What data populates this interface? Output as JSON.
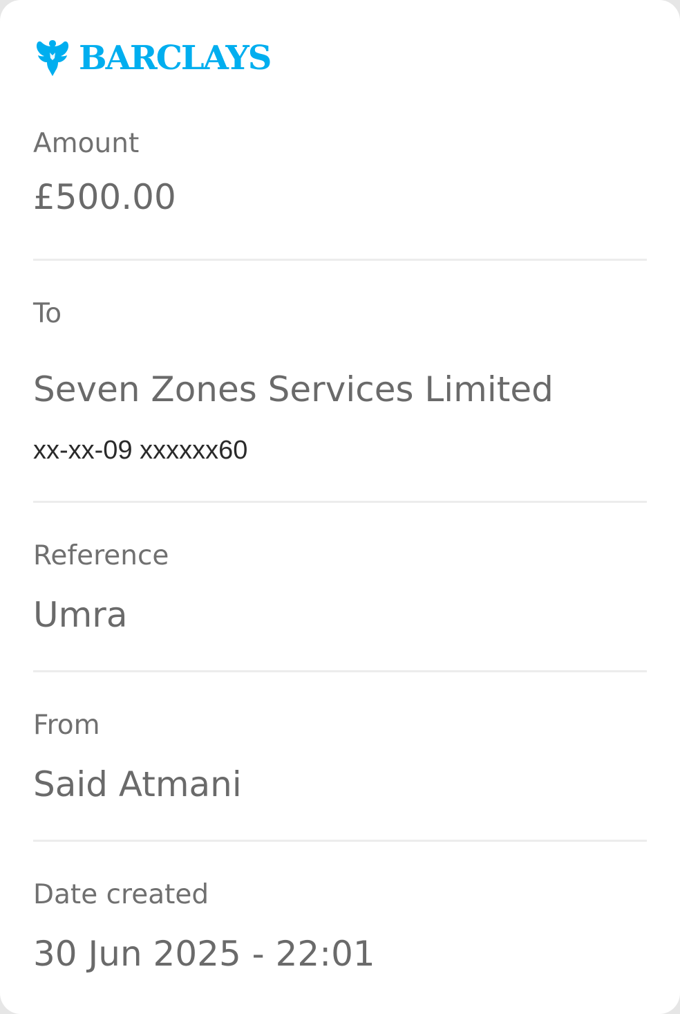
{
  "brand": {
    "name": "BARCLAYS",
    "color": "#00aeef",
    "logo_icon": "eagle-icon"
  },
  "details": {
    "amount_label": "Amount",
    "amount_value": "£500.00",
    "to_label": "To",
    "to_name": "Seven Zones Services Limited",
    "to_account": "xx-xx-09 xxxxxx60",
    "reference_label": "Reference",
    "reference_value": "Umra",
    "from_label": "From",
    "from_value": "Said Atmani",
    "date_label": "Date created",
    "date_value": "30 Jun 2025 - 22:01"
  }
}
